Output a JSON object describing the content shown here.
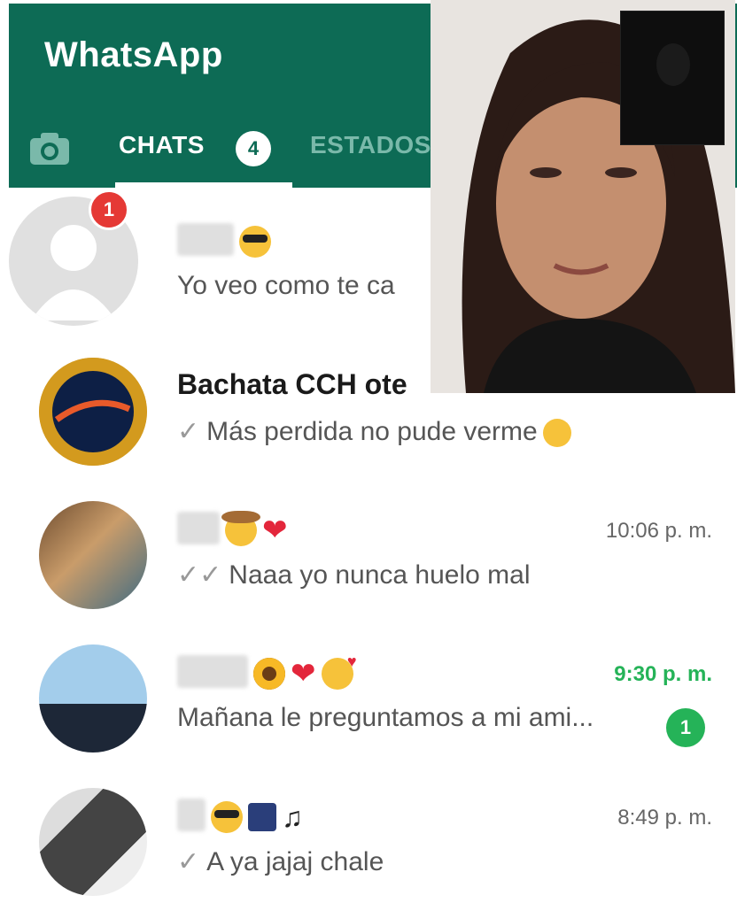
{
  "app": {
    "title": "WhatsApp",
    "accent": "#0d6b55",
    "unread_color": "#25b358"
  },
  "tabs": [
    {
      "label": "CHATS",
      "count": "4",
      "active": true
    },
    {
      "label": "ESTADOS",
      "active": false
    }
  ],
  "chats": [
    {
      "name": "",
      "preview": "Yo veo como te ca",
      "time": "",
      "unread": "",
      "avatar_badge": "1",
      "read_state": ""
    },
    {
      "name": "Bachata CCH ote",
      "preview": "Más perdida no pude verme",
      "time": "",
      "unread": "",
      "avatar_badge": "",
      "read_state": "sent"
    },
    {
      "name": "",
      "preview": "Naaa yo nunca huelo mal",
      "time": "10:06 p. m.",
      "unread": "",
      "avatar_badge": "",
      "read_state": "delivered"
    },
    {
      "name": "",
      "preview": "Mañana le preguntamos a mi ami...",
      "time": "9:30 p. m.",
      "unread": "1",
      "avatar_badge": "",
      "read_state": ""
    },
    {
      "name": "",
      "preview": "A ya jajaj chale",
      "time": "8:49 p. m.",
      "unread": "",
      "avatar_badge": "",
      "read_state": "sent"
    }
  ],
  "icons": {
    "camera": "camera-icon",
    "sent": "check-icon",
    "delivered": "double-check-icon"
  }
}
